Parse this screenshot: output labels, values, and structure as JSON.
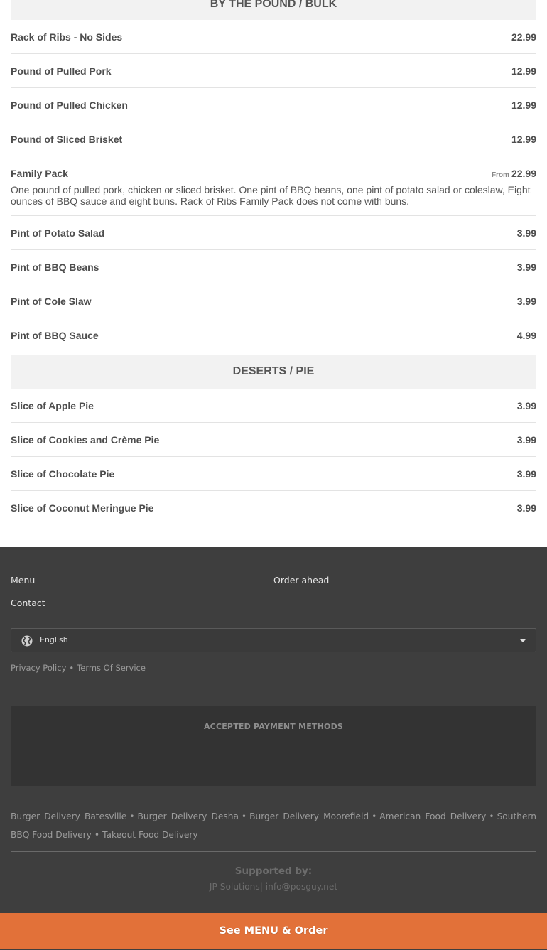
{
  "sections": [
    {
      "title": "BY THE POUND / BULK",
      "items": [
        {
          "name": "Rack of Ribs - No Sides",
          "price": "22.99"
        },
        {
          "name": "Pound of Pulled Pork",
          "price": "12.99"
        },
        {
          "name": "Pound of Pulled Chicken",
          "price": "12.99"
        },
        {
          "name": "Pound of Sliced Brisket",
          "price": "12.99"
        },
        {
          "name": "Family Pack",
          "price": "22.99",
          "price_prefix": "From",
          "description": "One pound of pulled pork, chicken or sliced brisket. One pint of BBQ beans, one pint of potato salad or coleslaw, Eight ounces of BBQ sauce and eight buns. Rack of Ribs Family Pack does not come with buns."
        },
        {
          "name": "Pint of Potato Salad",
          "price": "3.99"
        },
        {
          "name": "Pint of BBQ Beans",
          "price": "3.99"
        },
        {
          "name": "Pint of Cole Slaw",
          "price": "3.99"
        },
        {
          "name": "Pint of BBQ Sauce",
          "price": "4.99"
        }
      ]
    },
    {
      "title": "DESERTS / PIE",
      "items": [
        {
          "name": "Slice of Apple Pie",
          "price": "3.99"
        },
        {
          "name": "Slice of Cookies and Crème Pie",
          "price": "3.99"
        },
        {
          "name": "Slice of Chocolate Pie",
          "price": "3.99"
        },
        {
          "name": "Slice of Coconut Meringue Pie",
          "price": "3.99"
        }
      ]
    }
  ],
  "footer": {
    "links": {
      "menu": "Menu",
      "order_ahead": "Order ahead",
      "contact": "Contact"
    },
    "language": {
      "selected": "English",
      "icon": "globe-icon"
    },
    "legal": {
      "privacy": "Privacy Policy",
      "terms": "Terms Of Service",
      "separator": "•"
    },
    "payment_title": "ACCEPTED PAYMENT METHODS",
    "delivery_links": [
      "Burger Delivery Batesville",
      "Burger Delivery Desha",
      "Burger Delivery Moorefield",
      "American Food Delivery",
      "Southern BBQ Food Delivery",
      "Takeout Food Delivery"
    ],
    "supported_title": "Supported by:",
    "supported_company": "JP Solutions",
    "supported_separator": "|",
    "supported_email": "info@posguy.net"
  },
  "cta": {
    "label": "See MENU & Order"
  },
  "colors": {
    "accent": "#e27139",
    "footer_bg": "#3e3e3e",
    "section_bg": "#f2f2f2"
  }
}
